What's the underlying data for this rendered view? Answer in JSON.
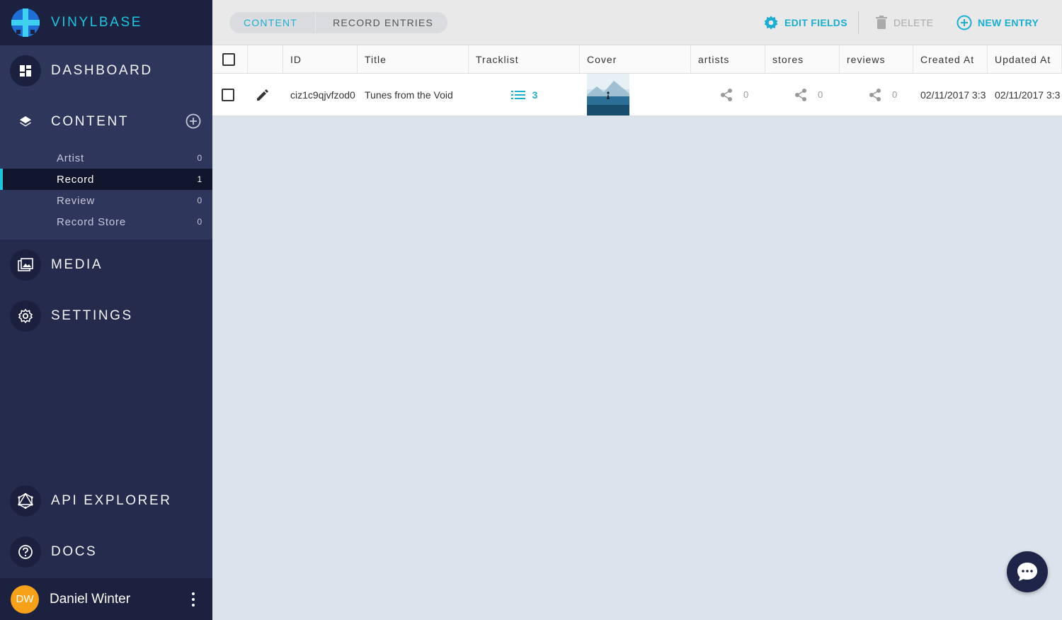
{
  "brand": {
    "name": "VINYLBASE"
  },
  "sidebar": {
    "dashboard": "DASHBOARD",
    "content": {
      "label": "CONTENT",
      "items": [
        {
          "label": "Artist",
          "count": "0"
        },
        {
          "label": "Record",
          "count": "1",
          "active": true
        },
        {
          "label": "Review",
          "count": "0"
        },
        {
          "label": "Record Store",
          "count": "0"
        }
      ]
    },
    "media": "MEDIA",
    "settings": "SETTINGS",
    "api_explorer": "API EXPLORER",
    "docs": "DOCS"
  },
  "user": {
    "initials": "DW",
    "name": "Daniel Winter"
  },
  "breadcrumb": [
    "CONTENT",
    "RECORD ENTRIES"
  ],
  "toolbar": {
    "edit_fields": "EDIT FIELDS",
    "delete": "DELETE",
    "new_entry": "NEW ENTRY"
  },
  "table": {
    "headers": [
      "ID",
      "Title",
      "Tracklist",
      "Cover",
      "artists",
      "stores",
      "reviews",
      "Created At",
      "Updated At"
    ],
    "rows": [
      {
        "id": "ciz1c9qjvfzod0",
        "title": "Tunes from the Void",
        "tracklist_count": "3",
        "artists": "0",
        "stores": "0",
        "reviews": "0",
        "created_at": "02/11/2017 3:3",
        "updated_at": "02/11/2017 3:3"
      }
    ]
  },
  "colors": {
    "accent": "#1fc4de",
    "sidebar": "#252b4d",
    "avatar": "#f7a11a"
  }
}
